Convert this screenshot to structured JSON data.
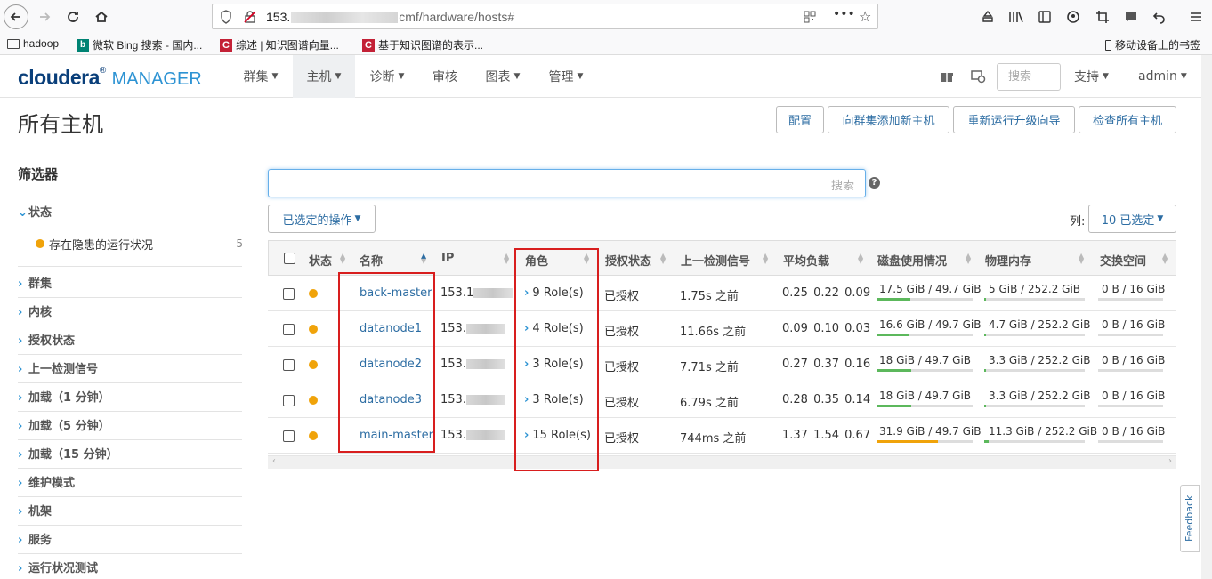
{
  "browser": {
    "url_prefix": "153.",
    "url_path": "cmf/hardware/hosts#",
    "bookmarks": [
      "hadoop",
      "微软 Bing 搜索 - 国内...",
      "综述 | 知识图谱向量...",
      "基于知识图谱的表示..."
    ],
    "mobile_bookmarks": "移动设备上的书签"
  },
  "header": {
    "logo_main": "cloudera",
    "logo_sub": "MANAGER",
    "menu": [
      "群集",
      "主机",
      "诊断",
      "审核",
      "图表",
      "管理"
    ],
    "search_placeholder": "搜索",
    "support": "支持",
    "user": "admin"
  },
  "page": {
    "title": "所有主机",
    "buttons": [
      "配置",
      "向群集添加新主机",
      "重新运行升级向导",
      "检查所有主机"
    ]
  },
  "filters": {
    "title": "筛选器",
    "status_group": "状态",
    "status_item": "存在隐患的运行状况",
    "status_count": "5",
    "groups": [
      "群集",
      "内核",
      "授权状态",
      "上一检测信号",
      "加载（1 分钟）",
      "加载（5 分钟）",
      "加载（15 分钟）",
      "维护模式",
      "机架",
      "服务",
      "运行状况测试"
    ]
  },
  "toolbar": {
    "search_placeholder": "搜索",
    "help": "?",
    "actions_label": "已选定的操作",
    "columns_label": "列:",
    "columns_button": "10 已选定"
  },
  "table": {
    "headers": [
      "状态",
      "名称",
      "IP",
      "角色",
      "授权状态",
      "上一检测信号",
      "平均负载",
      "磁盘使用情况",
      "物理内存",
      "交换空间"
    ],
    "rows": [
      {
        "name": "back-master",
        "ip_prefix": "153.1",
        "roles": "9 Role(s)",
        "auth": "已授权",
        "heartbeat": "1.75s 之前",
        "load": "0.25  0.22  0.09",
        "disk": "17.5 GiB / 49.7 GiB",
        "disk_frac": 0.35,
        "mem": "5 GiB / 252.2 GiB",
        "mem_frac": 0.02,
        "swap": "0 B / 16 GiB"
      },
      {
        "name": "datanode1",
        "ip_prefix": "153.",
        "roles": "4 Role(s)",
        "auth": "已授权",
        "heartbeat": "11.66s 之前",
        "load": "0.09  0.10  0.03",
        "disk": "16.6 GiB / 49.7 GiB",
        "disk_frac": 0.33,
        "mem": "4.7 GiB / 252.2 GiB",
        "mem_frac": 0.02,
        "swap": "0 B / 16 GiB"
      },
      {
        "name": "datanode2",
        "ip_prefix": "153.",
        "roles": "3 Role(s)",
        "auth": "已授权",
        "heartbeat": "7.71s 之前",
        "load": "0.27  0.37  0.16",
        "disk": "18 GiB / 49.7 GiB",
        "disk_frac": 0.36,
        "mem": "3.3 GiB / 252.2 GiB",
        "mem_frac": 0.01,
        "swap": "0 B / 16 GiB"
      },
      {
        "name": "datanode3",
        "ip_prefix": "153.",
        "roles": "3 Role(s)",
        "auth": "已授权",
        "heartbeat": "6.79s 之前",
        "load": "0.28  0.35  0.14",
        "disk": "18 GiB / 49.7 GiB",
        "disk_frac": 0.36,
        "mem": "3.3 GiB / 252.2 GiB",
        "mem_frac": 0.01,
        "swap": "0 B / 16 GiB"
      },
      {
        "name": "main-master",
        "ip_prefix": "153.",
        "roles": "15 Role(s)",
        "auth": "已授权",
        "heartbeat": "744ms 之前",
        "load": "1.37  1.54  0.67",
        "disk": "31.9 GiB / 49.7 GiB",
        "disk_frac": 0.64,
        "mem": "11.3 GiB / 252.2 GiB",
        "mem_frac": 0.04,
        "swap": "0 B / 16 GiB"
      }
    ]
  },
  "colors": {
    "link": "#2d6da3",
    "accent": "#2d93d3",
    "warning_dot": "#f0a30a",
    "disk_bar_ok": "#5cb85c",
    "disk_bar_warn": "#f0a30a",
    "highlight_box": "#d81e1e"
  },
  "feedback_label": "Feedback"
}
